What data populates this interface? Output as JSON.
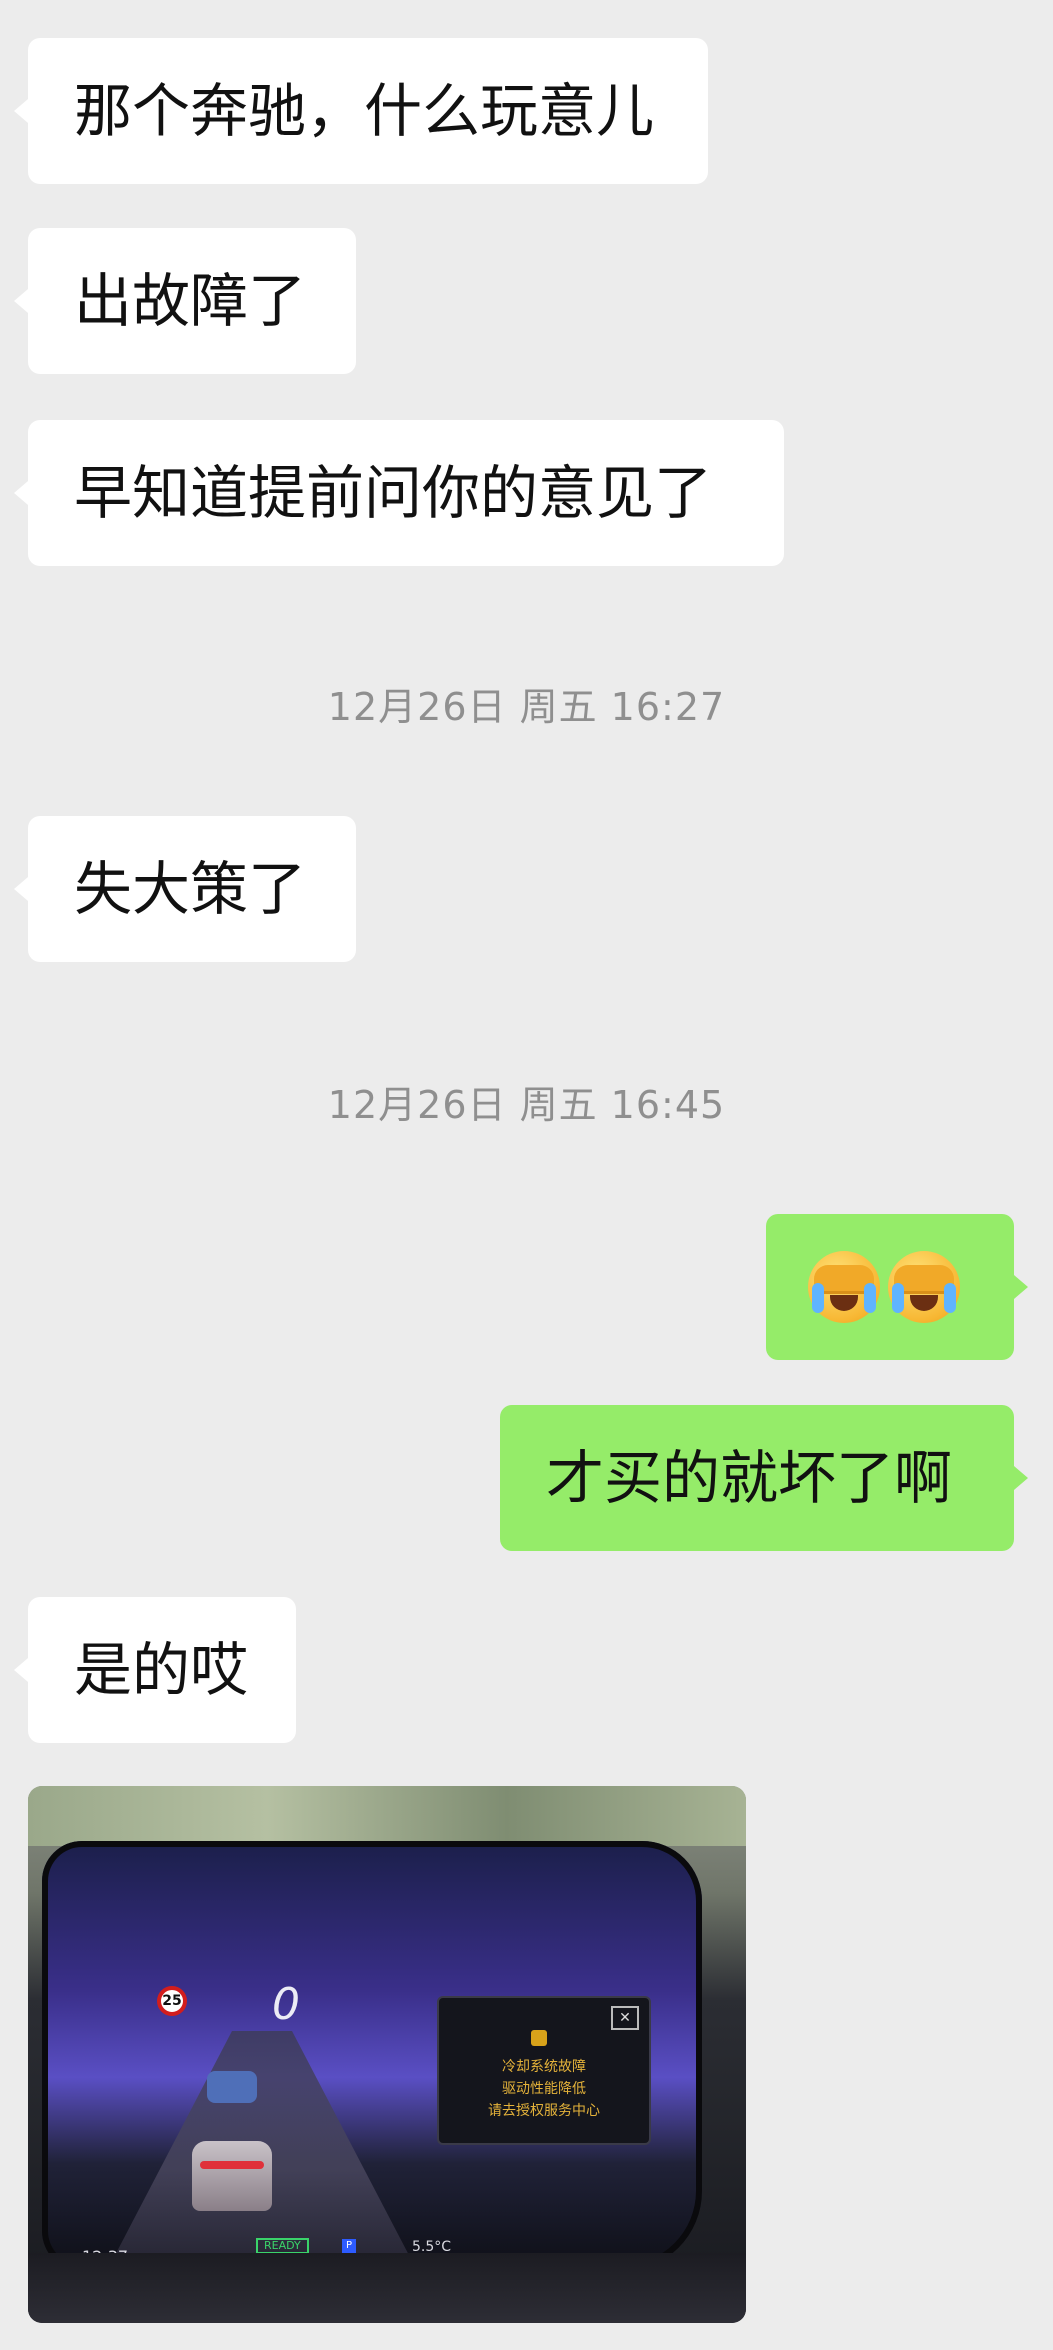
{
  "messages": [
    {
      "side": "in",
      "text": "那个奔驰，什么玩意儿"
    },
    {
      "side": "in",
      "text": "出故障了"
    },
    {
      "side": "in",
      "text": "早知道提前问你的意见了"
    },
    {
      "side": "in",
      "text": "失大策了"
    },
    {
      "side": "out",
      "text": "才买的就坏了啊"
    },
    {
      "side": "in",
      "text": "是的哎"
    }
  ],
  "timestamps": [
    "12月26日 周五 16:27",
    "12月26日 周五 16:45"
  ],
  "emoji_message": {
    "side": "out",
    "emojis": [
      "crying-face-emoji",
      "crying-face-emoji"
    ]
  },
  "photo": {
    "speed_limit": "25",
    "speed": "0",
    "warning_lines": [
      "冷却系统故障",
      "驱动性能降低",
      "请去授权服务中心"
    ],
    "ready_label": "READY",
    "clock": "12:37",
    "temperature": "5.5°C",
    "gear": "P"
  }
}
